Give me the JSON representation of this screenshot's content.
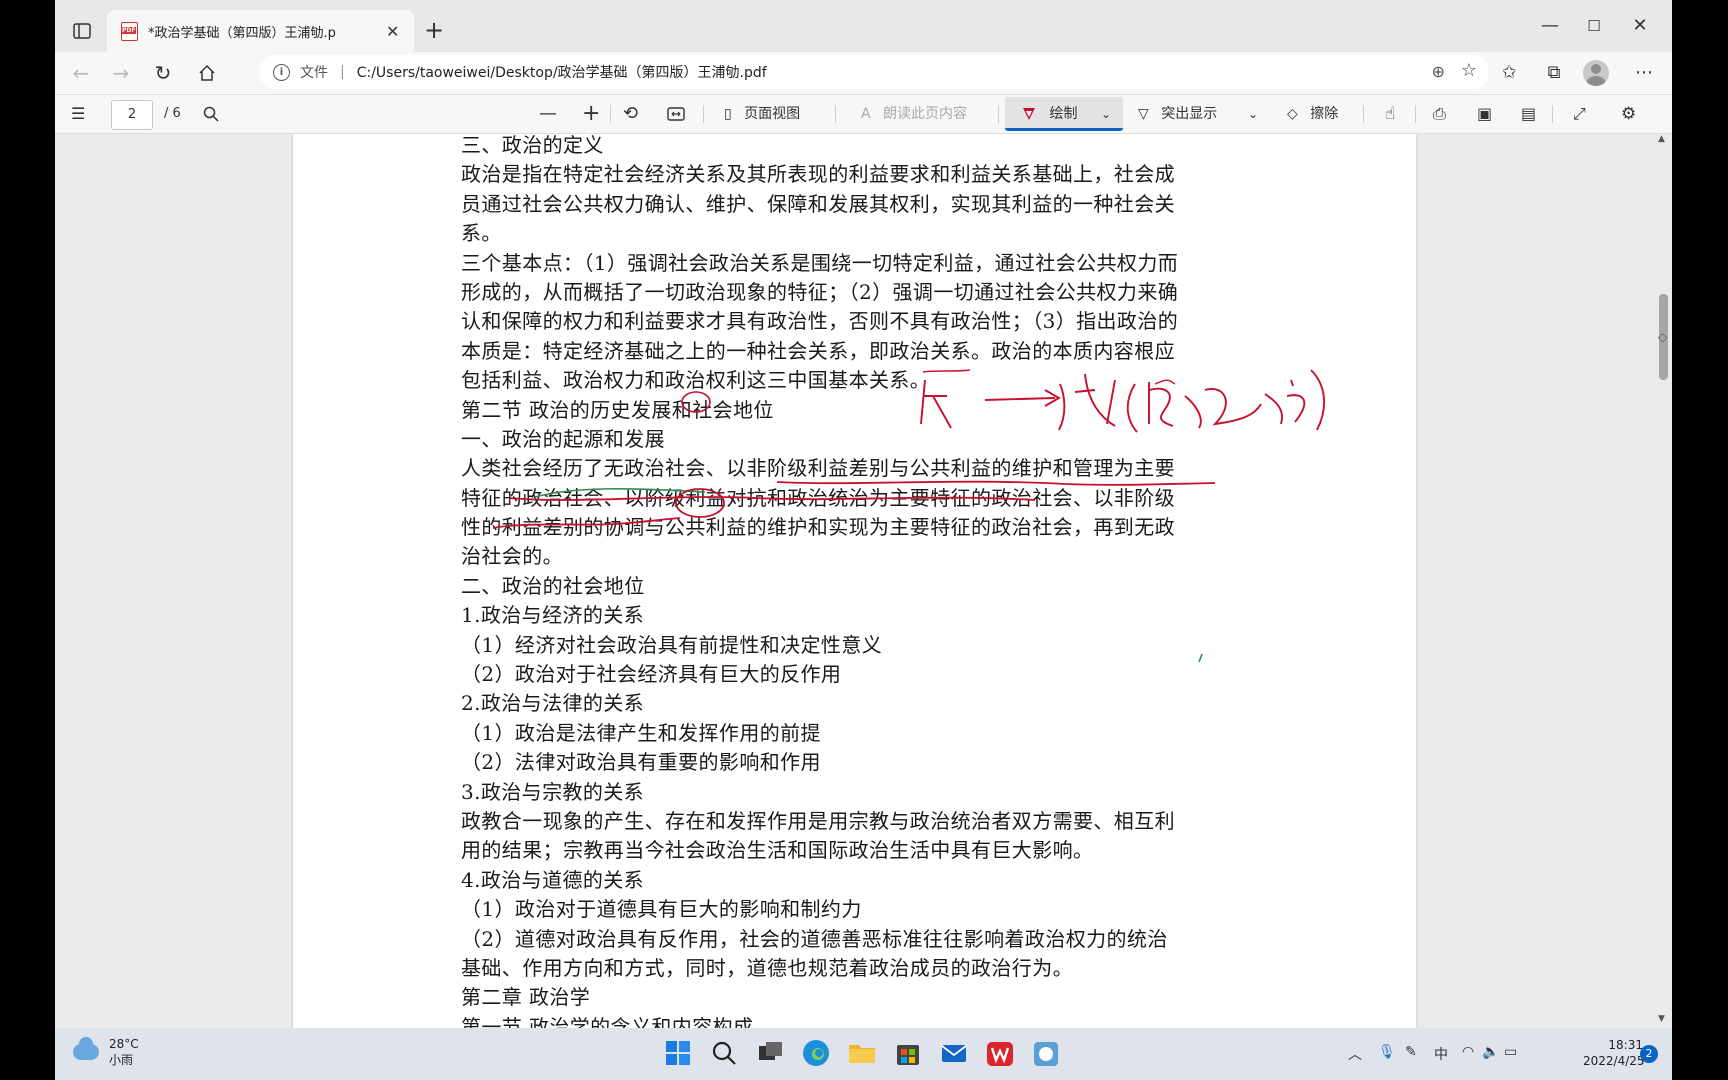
{
  "browser": {
    "tab_title": "*政治学基础（第四版）王浦劬.p",
    "url_scheme": "文件",
    "url": "C:/Users/taoweiwei/Desktop/政治学基础（第四版）王浦劬.pdf"
  },
  "pdf_toolbar": {
    "page_current": "2",
    "page_total": "/ 6",
    "page_view_label": "页面视图",
    "read_aloud_label": "朗读此页内容",
    "draw_label": "绘制",
    "highlight_label": "突出显示",
    "erase_label": "擦除"
  },
  "document": {
    "lines": [
      "三、政治的定义",
      "政治是指在特定社会经济关系及其所表现的利益要求和利益关系基础上，社会成",
      "员通过社会公共权力确认、维护、保障和发展其权利，实现其利益的一种社会关",
      "系。",
      "三个基本点：（1）强调社会政治关系是围绕一切特定利益，通过社会公共权力而",
      "形成的，从而概括了一切政治现象的特征；（2）强调一切通过社会公共权力来确",
      "认和保障的权力和利益要求才具有政治性，否则不具有政治性；（3）指出政治的",
      "本质是：特定经济基础之上的一种社会关系，即政治关系。政治的本质内容根应",
      "包括利益、政治权力和政治权利这三中国基本关系。",
      "第二节 政治的历史发展和社会地位",
      "一、政治的起源和发展",
      "人类社会经历了无政治社会、以非阶级利益差别与公共利益的维护和管理为主要",
      "特征的政治社会、以阶级利益对抗和政治统治为主要特征的政治社会、以非阶级",
      "性的利益差别的协调与公共利益的维护和实现为主要特征的政治社会，再到无政",
      "治社会的。",
      "二、政治的社会地位",
      "1.政治与经济的关系",
      "（1）经济对社会政治具有前提性和决定性意义",
      "（2）政治对于社会经济具有巨大的反作用",
      "2.政治与法律的关系",
      "（1）政治是法律产生和发挥作用的前提",
      "（2）法律对政治具有重要的影响和作用",
      "3.政治与宗教的关系",
      "政教合一现象的产生、存在和发挥作用是用宗教与政治统治者双方需要、相互利",
      "用的结果；宗教再当今社会政治生活和国际政治生活中具有巨大影响。",
      "4.政治与道德的关系",
      "（1）政治对于道德具有巨大的影响和制约力",
      "（2）道德对政治具有反作用，社会的道德善恶标准往往影响着政治权力的统治",
      "基础、作用方向和方式，同时，道德也规范着政治成员的政治行为。",
      "第二章 政治学",
      "第一节 政治学的含义和内容构成"
    ]
  },
  "taskbar": {
    "temperature": "28°C",
    "weather": "小雨",
    "ime": "中",
    "time": "18:31",
    "date": "2022/4/25",
    "notifications": "2"
  },
  "colors": {
    "ink_red": "#c8102e",
    "ink_green": "#2e8b57",
    "draw_accent": "#0b62c4"
  }
}
